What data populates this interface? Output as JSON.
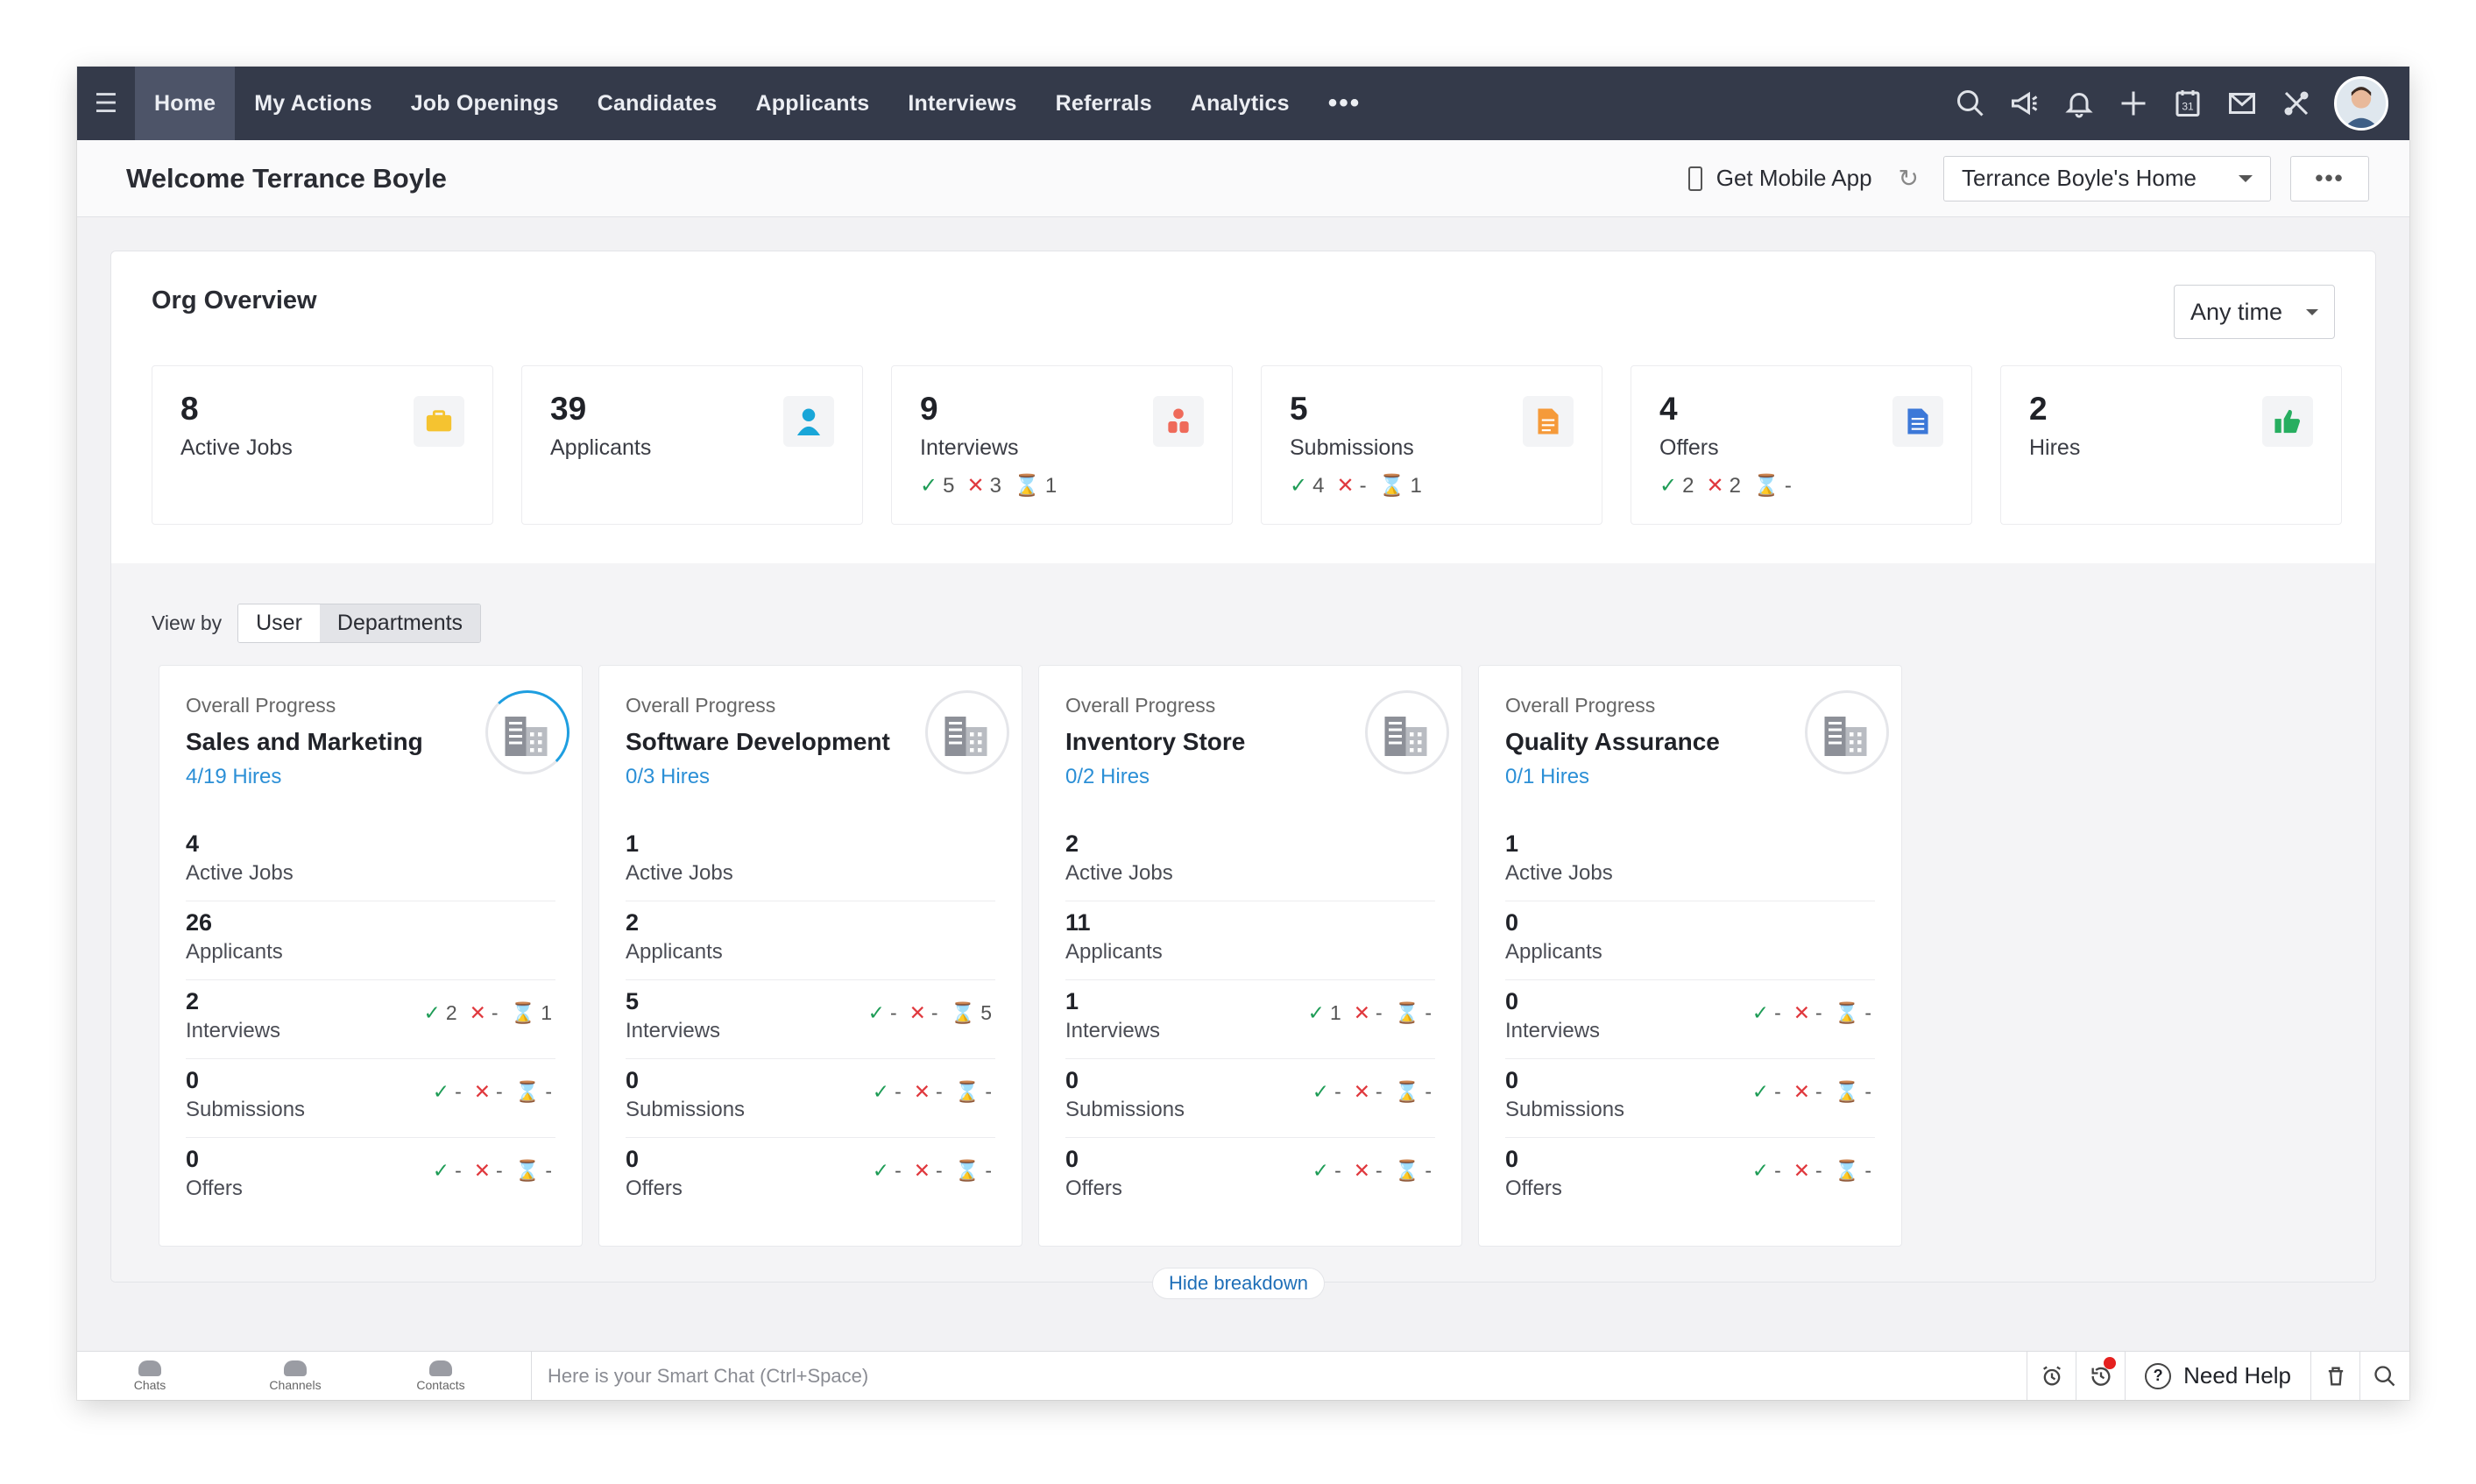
{
  "nav": {
    "items": [
      "Home",
      "My Actions",
      "Job Openings",
      "Candidates",
      "Applicants",
      "Interviews",
      "Referrals",
      "Analytics"
    ],
    "more": "•••",
    "icons": [
      "search-icon",
      "megaphone-icon",
      "bell-icon",
      "plus-icon",
      "calendar-icon",
      "mail-icon",
      "tools-icon"
    ],
    "calendar_day": "31"
  },
  "subheader": {
    "welcome": "Welcome Terrance Boyle",
    "mobile_app": "Get Mobile App",
    "home_select": "Terrance Boyle's Home",
    "more": "•••"
  },
  "org": {
    "title": "Org Overview",
    "time_filter": "Any time",
    "stats": [
      {
        "value": "8",
        "label": "Active Jobs",
        "icon": "briefcase-icon",
        "color": "#f5c330"
      },
      {
        "value": "39",
        "label": "Applicants",
        "icon": "user-icon",
        "color": "#19a6d8"
      },
      {
        "value": "9",
        "label": "Interviews",
        "icon": "people-icon",
        "color": "#ef6a5a",
        "status": {
          "ok": "5",
          "no": "3",
          "wait": "1"
        }
      },
      {
        "value": "5",
        "label": "Submissions",
        "icon": "document-icon",
        "color": "#f59a3a",
        "status": {
          "ok": "4",
          "no": "-",
          "wait": "1"
        }
      },
      {
        "value": "4",
        "label": "Offers",
        "icon": "offer-doc-icon",
        "color": "#3c78d8",
        "status": {
          "ok": "2",
          "no": "2",
          "wait": "-"
        }
      },
      {
        "value": "2",
        "label": "Hires",
        "icon": "thumbs-up-icon",
        "color": "#27ae60"
      }
    ]
  },
  "breakdown": {
    "view_by": "View by",
    "options": [
      "User",
      "Departments"
    ],
    "overall_label": "Overall Progress",
    "hide": "Hide breakdown",
    "departments": [
      {
        "name": "Sales and Marketing",
        "hires": "4/19 Hires",
        "metrics": [
          {
            "value": "4",
            "label": "Active Jobs"
          },
          {
            "value": "26",
            "label": "Applicants"
          },
          {
            "value": "2",
            "label": "Interviews",
            "status": {
              "ok": "2",
              "no": "-",
              "wait": "1"
            }
          },
          {
            "value": "0",
            "label": "Submissions",
            "status": {
              "ok": "-",
              "no": "-",
              "wait": "-"
            }
          },
          {
            "value": "0",
            "label": "Offers",
            "status": {
              "ok": "-",
              "no": "-",
              "wait": "-"
            }
          }
        ]
      },
      {
        "name": "Software Development",
        "hires": "0/3 Hires",
        "metrics": [
          {
            "value": "1",
            "label": "Active Jobs"
          },
          {
            "value": "2",
            "label": "Applicants"
          },
          {
            "value": "5",
            "label": "Interviews",
            "status": {
              "ok": "-",
              "no": "-",
              "wait": "5"
            }
          },
          {
            "value": "0",
            "label": "Submissions",
            "status": {
              "ok": "-",
              "no": "-",
              "wait": "-"
            }
          },
          {
            "value": "0",
            "label": "Offers",
            "status": {
              "ok": "-",
              "no": "-",
              "wait": "-"
            }
          }
        ]
      },
      {
        "name": "Inventory Store",
        "hires": "0/2 Hires",
        "metrics": [
          {
            "value": "2",
            "label": "Active Jobs"
          },
          {
            "value": "11",
            "label": "Applicants"
          },
          {
            "value": "1",
            "label": "Interviews",
            "status": {
              "ok": "1",
              "no": "-",
              "wait": "-"
            }
          },
          {
            "value": "0",
            "label": "Submissions",
            "status": {
              "ok": "-",
              "no": "-",
              "wait": "-"
            }
          },
          {
            "value": "0",
            "label": "Offers",
            "status": {
              "ok": "-",
              "no": "-",
              "wait": "-"
            }
          }
        ]
      },
      {
        "name": "Quality Assurance",
        "hires": "0/1 Hires",
        "metrics": [
          {
            "value": "1",
            "label": "Active Jobs"
          },
          {
            "value": "0",
            "label": "Applicants"
          },
          {
            "value": "0",
            "label": "Interviews",
            "status": {
              "ok": "-",
              "no": "-",
              "wait": "-"
            }
          },
          {
            "value": "0",
            "label": "Submissions",
            "status": {
              "ok": "-",
              "no": "-",
              "wait": "-"
            }
          },
          {
            "value": "0",
            "label": "Offers",
            "status": {
              "ok": "-",
              "no": "-",
              "wait": "-"
            }
          }
        ]
      }
    ]
  },
  "bottombar": {
    "tabs": [
      "Chats",
      "Channels",
      "Contacts"
    ],
    "chat_placeholder": "Here is your Smart Chat (Ctrl+Space)",
    "need_help": "Need Help",
    "help_glyph": "?"
  }
}
